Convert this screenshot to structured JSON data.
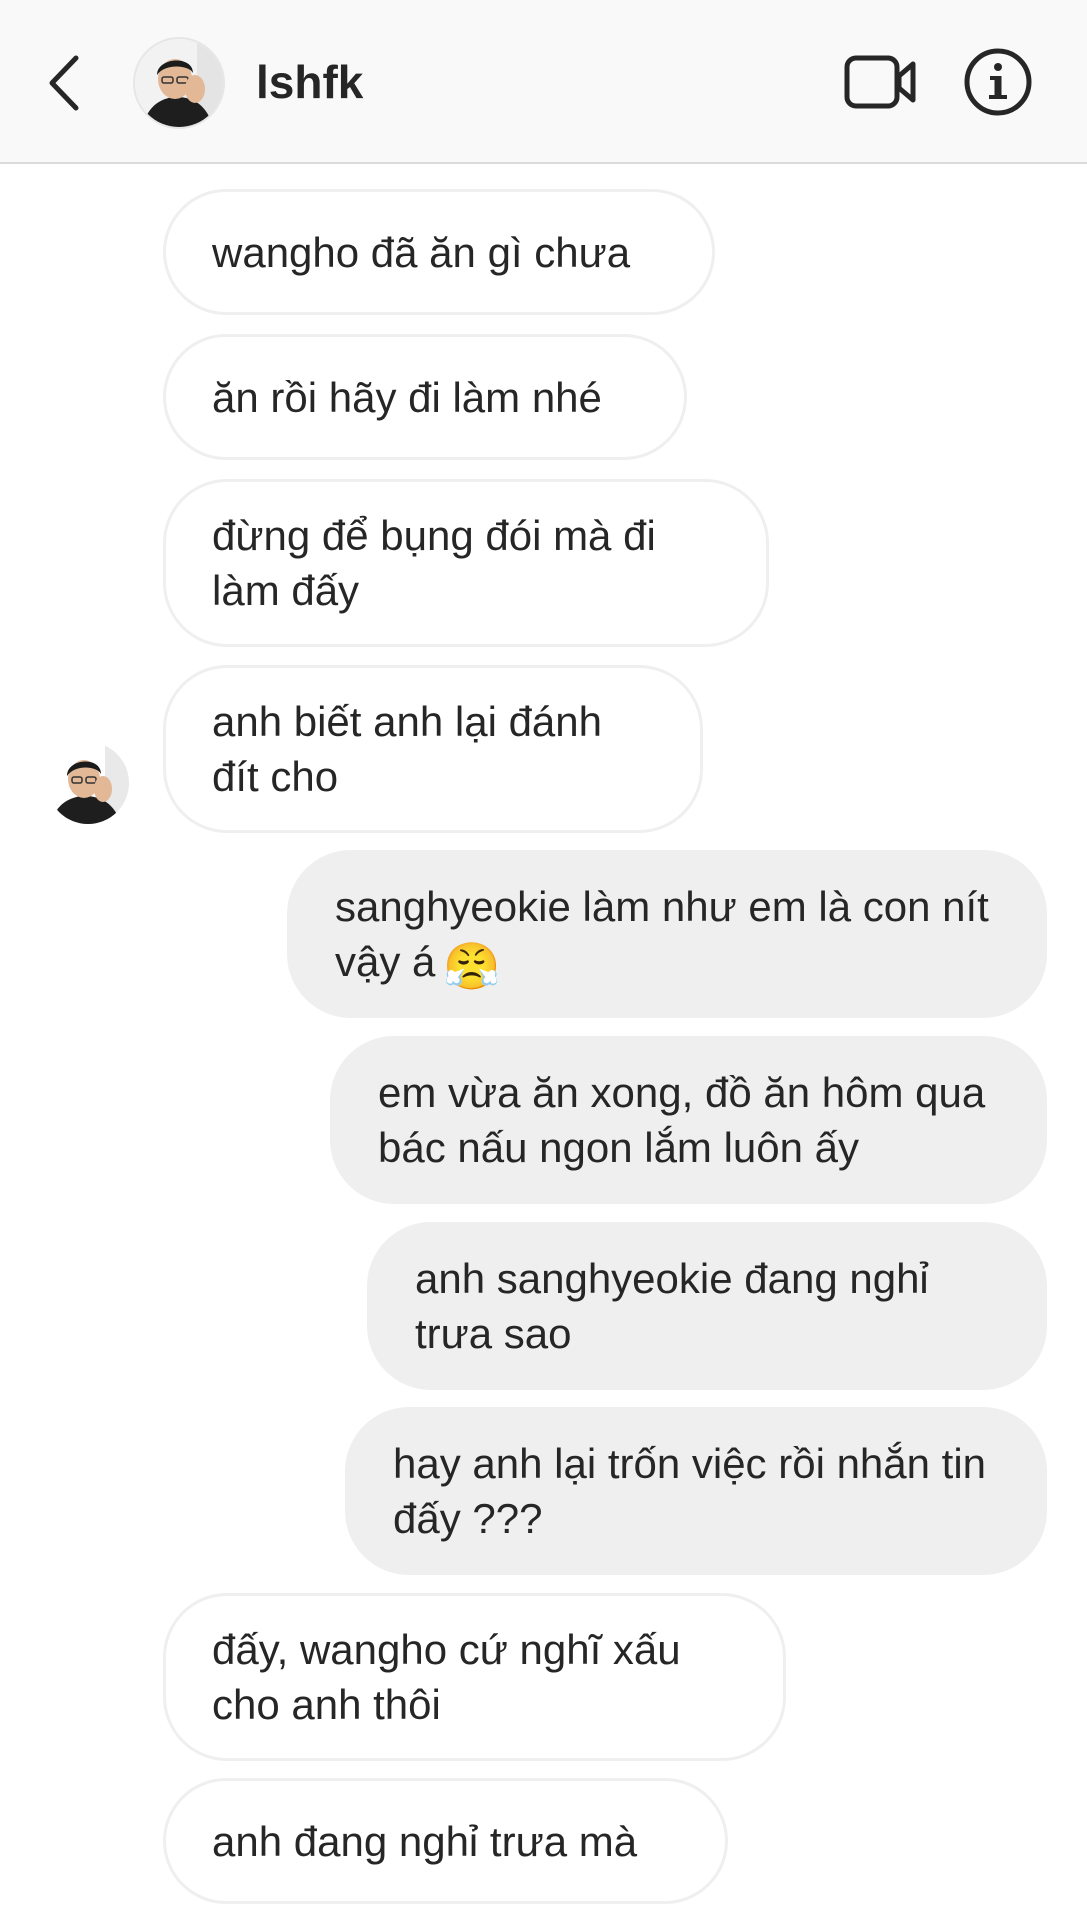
{
  "header": {
    "username": "lshfk",
    "icons": {
      "back": "chevron-left-icon",
      "video": "video-camera-icon",
      "info": "info-circle-icon"
    }
  },
  "messages": [
    {
      "direction": "incoming",
      "text": "wangho đã ăn gì chưa"
    },
    {
      "direction": "incoming",
      "text": "ăn rồi hãy đi làm nhé"
    },
    {
      "direction": "incoming",
      "text": "đừng để bụng đói mà đi làm đấy"
    },
    {
      "direction": "incoming",
      "text": "anh biết anh lại đánh đít cho"
    },
    {
      "direction": "outgoing",
      "text": "sanghyeokie làm như em là con nít vậy á",
      "emoji": "😤"
    },
    {
      "direction": "outgoing",
      "text": "em vừa ăn xong, đồ ăn hôm qua bác nấu ngon lắm luôn ấy"
    },
    {
      "direction": "outgoing",
      "text": "anh sanghyeokie đang nghỉ trưa sao"
    },
    {
      "direction": "outgoing",
      "text": "hay anh lại trốn việc rồi nhắn tin đấy ???"
    },
    {
      "direction": "incoming",
      "text": "đấy, wangho cứ nghĩ xấu cho anh thôi"
    },
    {
      "direction": "incoming",
      "text": "anh đang nghỉ trưa mà"
    }
  ],
  "colors": {
    "header_bg": "#f9f9f9",
    "incoming_bg": "#ffffff",
    "incoming_border": "#efefef",
    "outgoing_bg": "#efefef",
    "text": "#262626"
  }
}
